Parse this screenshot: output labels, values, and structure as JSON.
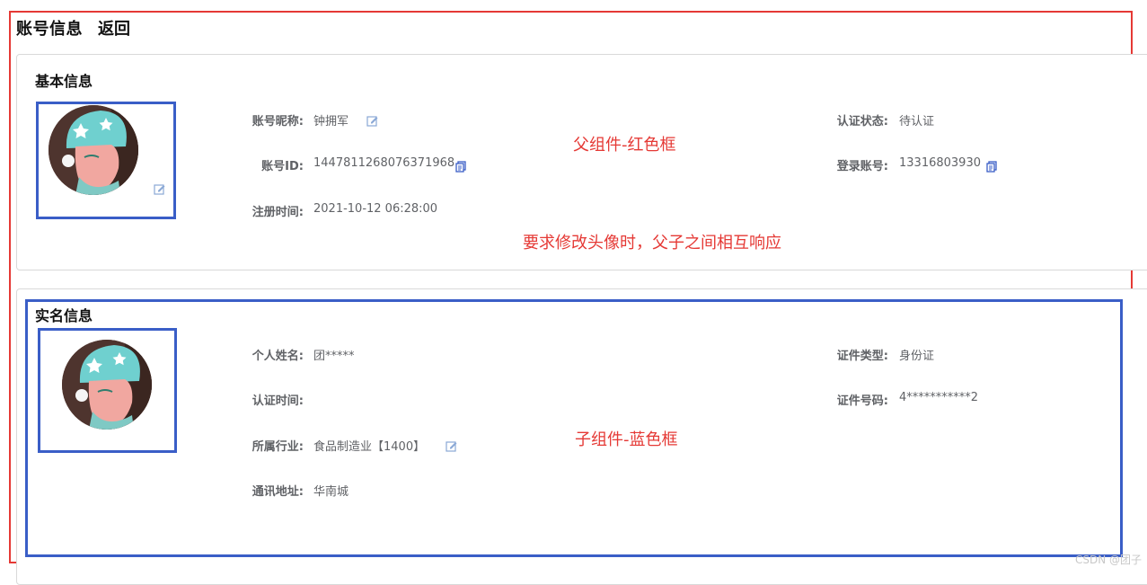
{
  "header": {
    "title": "账号信息",
    "back_label": "返回"
  },
  "basic": {
    "section_title": "基本信息",
    "fields": {
      "nickname": {
        "label": "账号昵称:",
        "value": "钟拥军"
      },
      "auth_status": {
        "label": "认证状态:",
        "value": "待认证"
      },
      "account_id": {
        "label": "账号ID:",
        "value": "1447811268076371968"
      },
      "login_account": {
        "label": "登录账号:",
        "value": "13316803930"
      },
      "register_time": {
        "label": "注册时间:",
        "value": "2021-10-12 06:28:00"
      }
    }
  },
  "real": {
    "section_title": "实名信息",
    "fields": {
      "name": {
        "label": "个人姓名:",
        "value": "团*****"
      },
      "id_type": {
        "label": "证件类型:",
        "value": "身份证"
      },
      "auth_time": {
        "label": "认证时间:",
        "value": ""
      },
      "id_number": {
        "label": "证件号码:",
        "value": "4***********2"
      },
      "industry": {
        "label": "所属行业:",
        "value": "食品制造业【1400】"
      },
      "address": {
        "label": "通讯地址:",
        "value": "华南城"
      }
    }
  },
  "annotations": {
    "parent": "父组件-红色框",
    "requirement": "要求修改头像时，父子之间相互响应",
    "child": "子组件-蓝色框"
  },
  "watermark": "CSDN @团子",
  "colors": {
    "red_frame": "#e53935",
    "blue_frame": "#3a5ec7",
    "edit_icon": "#8aa8d6",
    "copy_icon": "#3a5ec7"
  },
  "icons": [
    "edit-icon",
    "copy-icon"
  ]
}
